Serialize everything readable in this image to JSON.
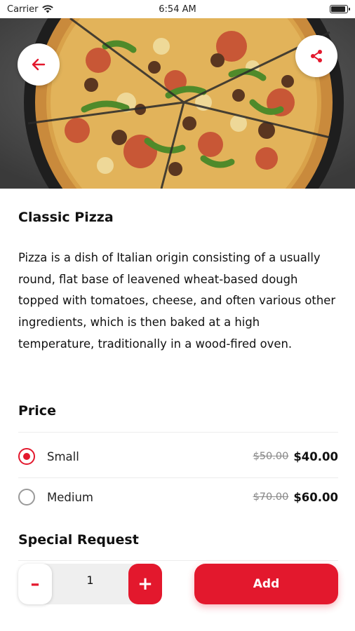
{
  "status_bar": {
    "carrier": "Carrier",
    "time": "6:54 AM"
  },
  "hero": {
    "image_alt": "Pizza with sausage and green peppers"
  },
  "product": {
    "title": "Classic Pizza",
    "description": "Pizza is a dish of Italian origin consisting of a usually round, flat base of leavened wheat-based dough topped with tomatoes, cheese, and often various other ingredients, which is then baked at a high temperature, traditionally in a wood-fired oven."
  },
  "price": {
    "title": "Price",
    "options": [
      {
        "label": "Small",
        "old_price": "$50.00",
        "price": "$40.00",
        "selected": true
      },
      {
        "label": "Medium",
        "old_price": "$70.00",
        "price": "$60.00",
        "selected": false
      }
    ]
  },
  "special_request": {
    "title": "Special Request"
  },
  "cart": {
    "quantity": "1",
    "minus_label": "–",
    "plus_label": "+",
    "add_label": "Add"
  },
  "colors": {
    "accent": "#e3182d"
  },
  "icons": {
    "back": "arrow-left-icon",
    "share": "share-icon",
    "wifi": "wifi-icon",
    "battery": "battery-icon"
  }
}
